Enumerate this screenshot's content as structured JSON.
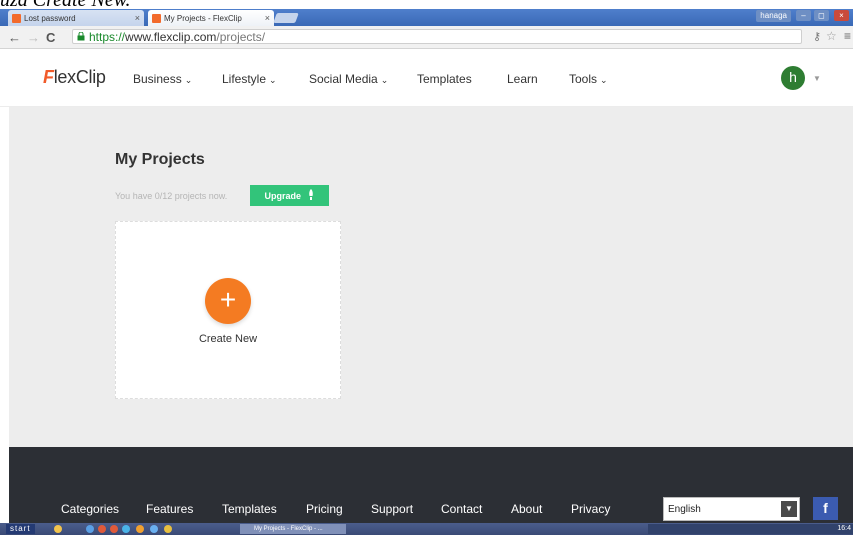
{
  "caption": "uza Create New.",
  "browser": {
    "tabs": [
      {
        "label": "Lost password",
        "active": false
      },
      {
        "label": "My Projects - FlexClip",
        "active": true
      }
    ],
    "user": "hanaga",
    "url_scheme": "https://",
    "url_host": "www.flexclip.com",
    "url_path": "/projects/"
  },
  "site": {
    "logo_f": "F",
    "logo_rest": "lexClip",
    "nav": [
      {
        "label": "Business",
        "dropdown": true
      },
      {
        "label": "Lifestyle",
        "dropdown": true
      },
      {
        "label": "Social Media",
        "dropdown": true
      },
      {
        "label": "Templates",
        "dropdown": false
      },
      {
        "label": "Learn",
        "dropdown": false
      },
      {
        "label": "Tools",
        "dropdown": true
      }
    ],
    "avatar_letter": "h"
  },
  "main": {
    "title": "My Projects",
    "subtitle": "You have 0/12 projects now.",
    "upgrade_label": "Upgrade",
    "create_label": "Create New"
  },
  "footer": {
    "links": [
      "Categories",
      "Features",
      "Templates",
      "Pricing",
      "Support",
      "Contact",
      "About",
      "Privacy"
    ],
    "language": "English",
    "social": "f"
  },
  "taskbar": {
    "start": "start",
    "task": "My Projects - FlexClip - ...",
    "clock": "16:4"
  },
  "colors": {
    "brand_orange": "#f15b2a",
    "create_button": "#f47b22",
    "upgrade_green": "#32c47a",
    "avatar_green": "#2e7d32",
    "footer_bg": "#2c2f35"
  }
}
